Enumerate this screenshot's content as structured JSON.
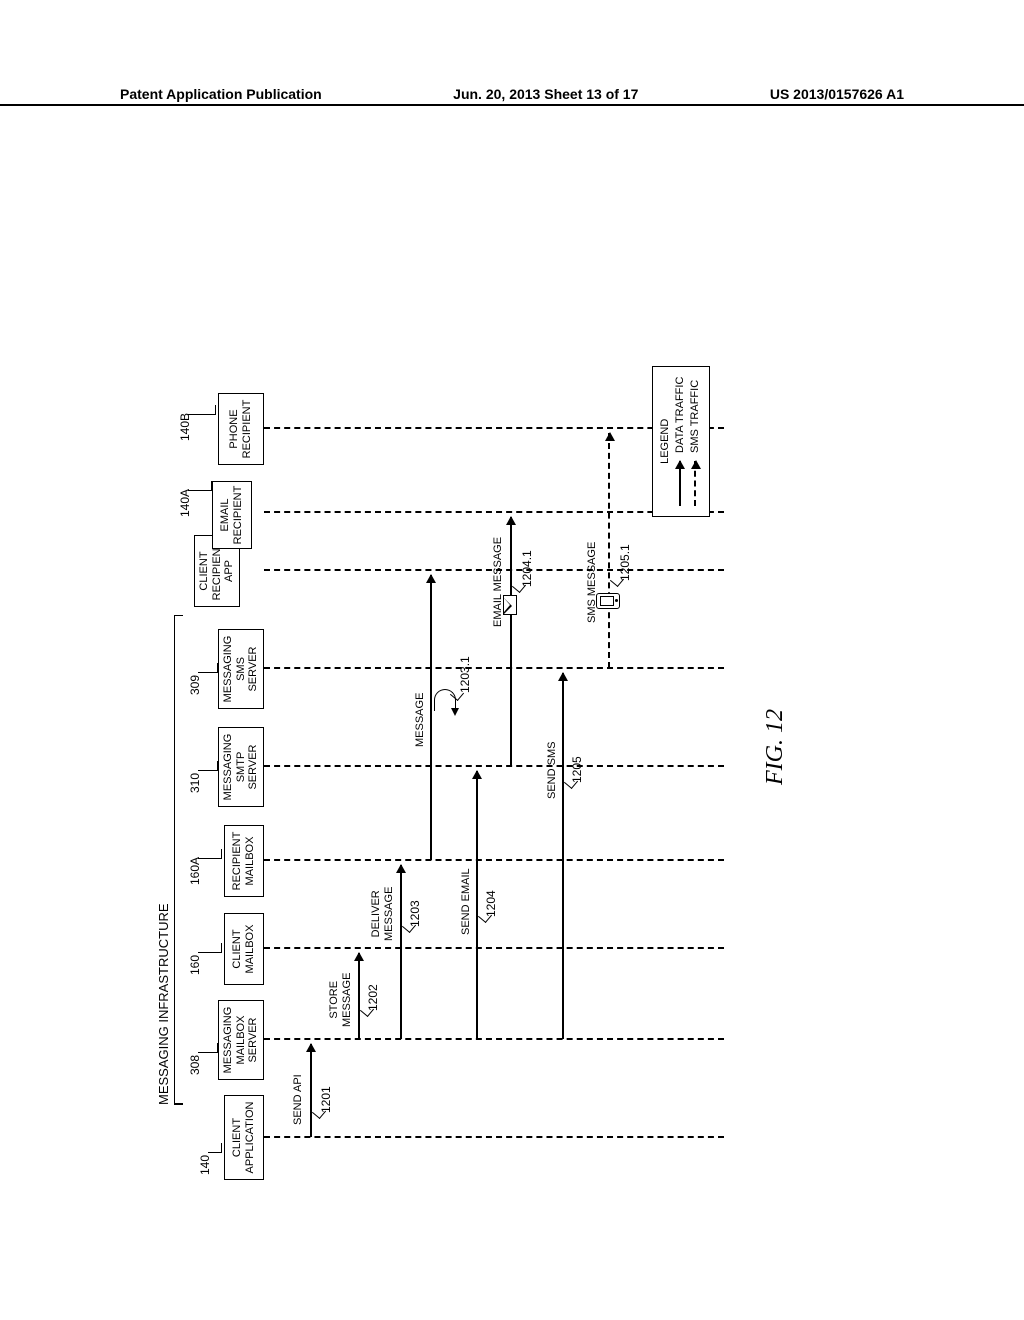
{
  "header": {
    "left": "Patent Application Publication",
    "center": "Jun. 20, 2013  Sheet 13 of 17",
    "right": "US 2013/0157626 A1"
  },
  "group_label": "MESSAGING INFRASTRUCTURE",
  "actors": [
    {
      "id": "client_app",
      "label": "CLIENT\nAPPLICATION",
      "ref": "140"
    },
    {
      "id": "mbox_srv",
      "label": "MESSAGING\nMAILBOX\nSERVER",
      "ref": "308"
    },
    {
      "id": "client_mbox",
      "label": "CLIENT\nMAILBOX",
      "ref": "160"
    },
    {
      "id": "recip_mbox",
      "label": "RECIPIENT\nMAILBOX",
      "ref": "160A"
    },
    {
      "id": "smtp_srv",
      "label": "MESSAGING\nSMTP\nSERVER",
      "ref": "310"
    },
    {
      "id": "sms_srv",
      "label": "MESSAGING\nSMS\nSERVER",
      "ref": "309"
    },
    {
      "id": "client_recip_app",
      "label": "CLIENT\nRECIPIENT\nAPP",
      "ref": ""
    },
    {
      "id": "email_recip",
      "label": "EMAIL\nRECIPIENT",
      "ref": "140A"
    },
    {
      "id": "phone_recip",
      "label": "PHONE\nRECIPIENT",
      "ref": "140B"
    }
  ],
  "messages": [
    {
      "label": "SEND API",
      "ref": "1201"
    },
    {
      "label": "STORE\nMESSAGE",
      "ref": "1202"
    },
    {
      "label": "DELIVER\nMESSAGE",
      "ref": "1203"
    },
    {
      "label": "MESSAGE",
      "ref": "1203.1",
      "type": "self"
    },
    {
      "label": "SEND EMAIL",
      "ref": "1204"
    },
    {
      "label": "EMAIL MESSAGE",
      "ref": "1204.1",
      "icon": "envelope"
    },
    {
      "label": "SEND SMS",
      "ref": "1205"
    },
    {
      "label": "SMS MESSAGE",
      "ref": "1205.1",
      "icon": "phone",
      "style": "dashed"
    }
  ],
  "legend": {
    "title": "LEGEND",
    "items": [
      {
        "label": "DATA TRAFFIC",
        "style": "solid"
      },
      {
        "label": "SMS TRAFFIC",
        "style": "dashed"
      }
    ]
  },
  "figure_label": "FIG. 12"
}
